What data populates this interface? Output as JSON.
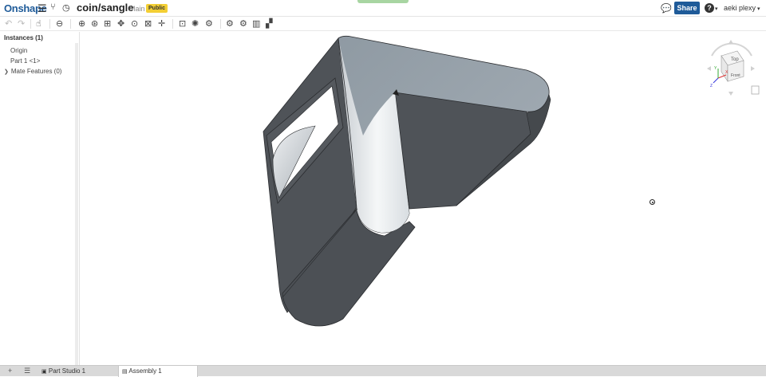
{
  "app": {
    "logo": "Onshape"
  },
  "document": {
    "name": "coin/sangle",
    "workspace": "Main",
    "badge": "Public"
  },
  "header": {
    "share_label": "Share",
    "help_label": "?",
    "user_name": "aeki plexy"
  },
  "sidebar": {
    "title": "Instances (1)",
    "items": [
      {
        "label": "Origin"
      },
      {
        "label": "Part 1 <1>"
      },
      {
        "label": "Mate Features (0)"
      }
    ]
  },
  "viewcube": {
    "face_top": "Top",
    "face_front": "Front",
    "axis_x": "X",
    "axis_y": "Y",
    "axis_z": "Z"
  },
  "tabs": [
    {
      "label": "Part Studio 1",
      "active": false
    },
    {
      "label": "Assembly 1",
      "active": true
    }
  ],
  "colors": {
    "brand": "#1f5b99",
    "badge": "#f3cf34",
    "share": "#1f5b99",
    "model_top": "#9aa4ad",
    "model_side": "#4e5257"
  }
}
